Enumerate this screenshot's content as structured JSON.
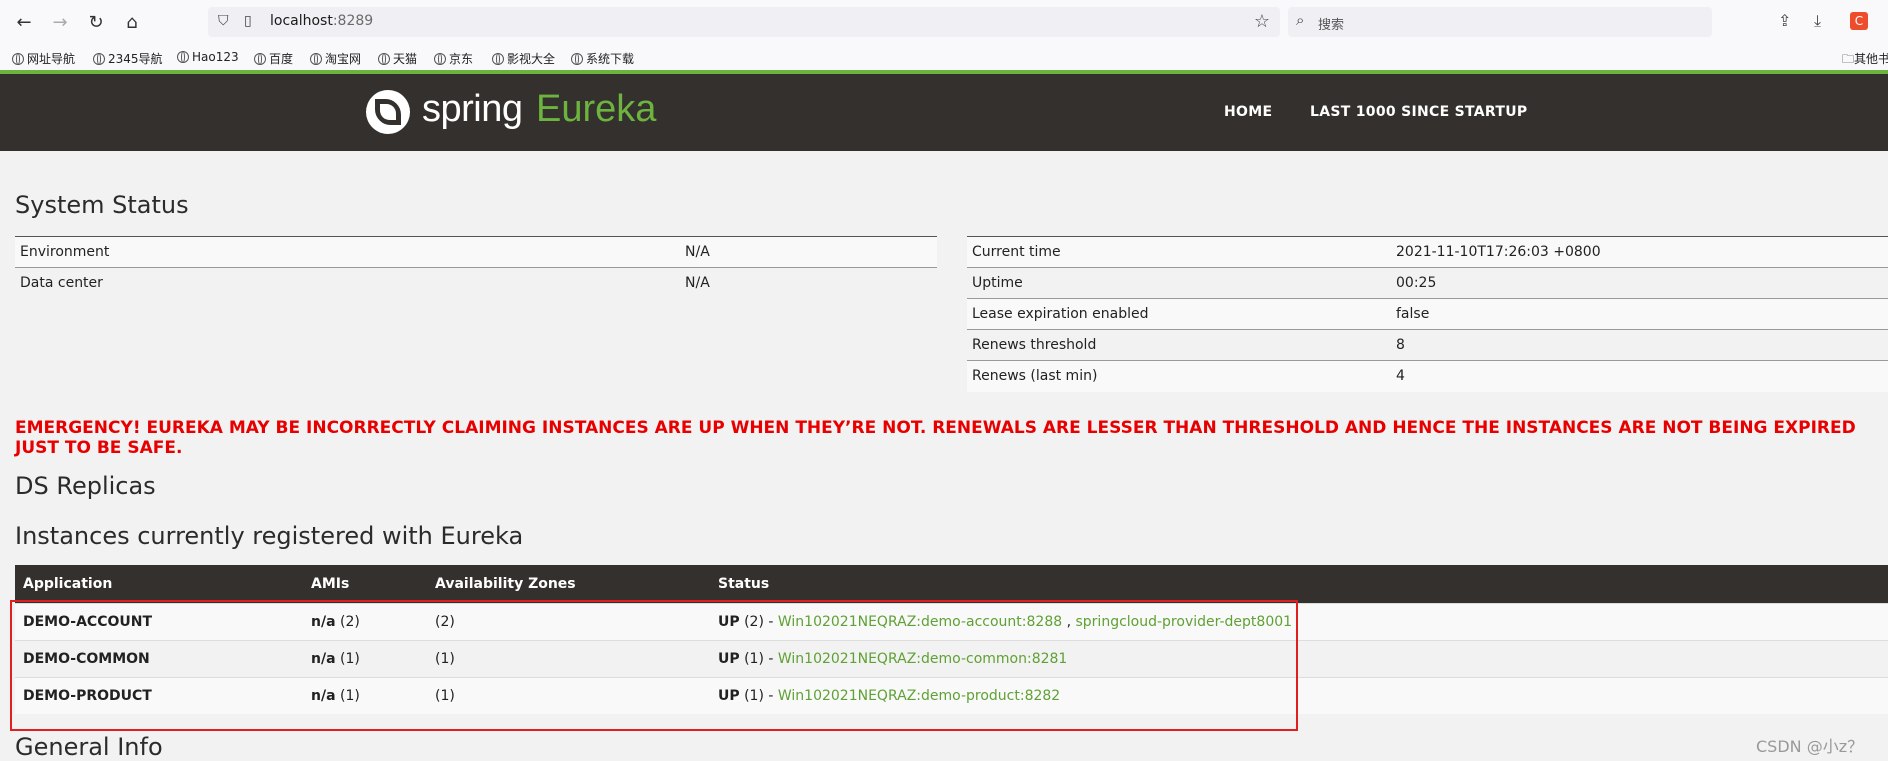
{
  "browser": {
    "url_host": "localhost",
    "url_port": ":8289",
    "search_placeholder": "搜索",
    "ext_label": "C",
    "bookmarks": [
      "网址导航",
      "2345导航",
      "Hao123",
      "百度",
      "淘宝网",
      "天猫",
      "京东",
      "影视大全",
      "系统下载"
    ],
    "other_bookmarks": "其他书"
  },
  "header": {
    "logo_spring": "spring",
    "logo_eureka": "Eureka",
    "nav": [
      "HOME",
      "LAST 1000 SINCE STARTUP"
    ]
  },
  "system_status": {
    "title": "System Status",
    "left": [
      {
        "label": "Environment",
        "value": "N/A"
      },
      {
        "label": "Data center",
        "value": "N/A"
      }
    ],
    "right": [
      {
        "label": "Current time",
        "value": "2021-11-10T17:26:03 +0800"
      },
      {
        "label": "Uptime",
        "value": "00:25"
      },
      {
        "label": "Lease expiration enabled",
        "value": "false"
      },
      {
        "label": "Renews threshold",
        "value": "8"
      },
      {
        "label": "Renews (last min)",
        "value": "4"
      }
    ]
  },
  "emergency": "EMERGENCY! EUREKA MAY BE INCORRECTLY CLAIMING INSTANCES ARE UP WHEN THEY’RE NOT. RENEWALS ARE LESSER THAN THRESHOLD AND HENCE THE INSTANCES ARE NOT BEING EXPIRED JUST TO BE SAFE.",
  "ds_replicas_title": "DS Replicas",
  "instances": {
    "title": "Instances currently registered with Eureka",
    "columns": [
      "Application",
      "AMIs",
      "Availability Zones",
      "Status"
    ],
    "rows": [
      {
        "app": "DEMO-ACCOUNT",
        "ami_bold": "n/a",
        "ami_count": " (2)",
        "zones": "(2)",
        "status_bold": "UP",
        "status_count": " (2) - ",
        "links": [
          "Win102021NEQRAZ:demo-account:8288",
          "springcloud-provider-dept8001"
        ],
        "sep": " , "
      },
      {
        "app": "DEMO-COMMON",
        "ami_bold": "n/a",
        "ami_count": " (1)",
        "zones": "(1)",
        "status_bold": "UP",
        "status_count": " (1) - ",
        "links": [
          "Win102021NEQRAZ:demo-common:8281"
        ]
      },
      {
        "app": "DEMO-PRODUCT",
        "ami_bold": "n/a",
        "ami_count": " (1)",
        "zones": "(1)",
        "status_bold": "UP",
        "status_count": " (1) - ",
        "links": [
          "Win102021NEQRAZ:demo-product:8282"
        ]
      }
    ]
  },
  "general_info_title": "General Info",
  "watermark": "CSDN @小z？",
  "colors": {
    "spring_green": "#6db33f",
    "header_bg": "#34302d",
    "emergency_red": "#e80000",
    "highlight_box": "#e02020"
  }
}
